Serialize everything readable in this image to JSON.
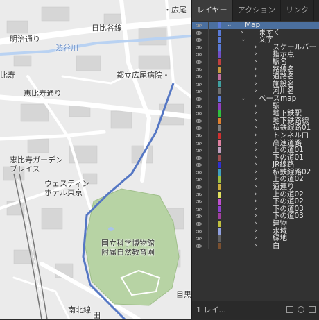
{
  "map": {
    "labels": [
      {
        "id": "hiroo-top",
        "text": "・広尾"
      },
      {
        "id": "meiji-dori",
        "text": "明治通り"
      },
      {
        "id": "hibiya-line",
        "text": "日比谷線"
      },
      {
        "id": "shibuya-gawa",
        "text": "渋谷川"
      },
      {
        "id": "hiroo-hospital",
        "text": "都立広尾病院・"
      },
      {
        "id": "ebisu",
        "text": "比寿"
      },
      {
        "id": "ebisu-dori",
        "text": "恵比寿通り"
      },
      {
        "id": "garden-place",
        "text": "恵比寿ガーデン\nプレイス"
      },
      {
        "id": "westin",
        "text": "ウェスティン\nホテル東京"
      },
      {
        "id": "museum",
        "text": "国立科学博物館\n附属自然教育園"
      },
      {
        "id": "nanboku-line",
        "text": "南北線"
      },
      {
        "id": "meguro",
        "text": "目黒"
      },
      {
        "id": "kita",
        "text": "田"
      }
    ]
  },
  "panel": {
    "tabs": [
      {
        "label": "レイヤー",
        "active": true
      },
      {
        "label": "アクション",
        "active": false
      },
      {
        "label": "リンク",
        "active": false
      }
    ],
    "layers": [
      {
        "name": "Map",
        "level": 0,
        "expanded": true,
        "color": "#5a7bd8",
        "top": true
      },
      {
        "name": "ますく",
        "level": 1,
        "expanded": false,
        "color": "#5a7bd8"
      },
      {
        "name": "文字",
        "level": 1,
        "expanded": true,
        "color": "#5a7bd8"
      },
      {
        "name": "スケールバー",
        "level": 2,
        "expanded": false,
        "color": "#5a7bd8"
      },
      {
        "name": "指示点",
        "level": 2,
        "expanded": false,
        "color": "#7050c8"
      },
      {
        "name": "駅名",
        "level": 2,
        "expanded": false,
        "color": "#c04040"
      },
      {
        "name": "路線名",
        "level": 2,
        "expanded": false,
        "color": "#c89b40"
      },
      {
        "name": "道路名",
        "level": 2,
        "expanded": false,
        "color": "#c070a0"
      },
      {
        "name": "施設名",
        "level": 2,
        "expanded": false,
        "color": "#40a0a0"
      },
      {
        "name": "河川名",
        "level": 2,
        "expanded": false,
        "color": "#707070"
      },
      {
        "name": "ベースmap",
        "level": 1,
        "expanded": true,
        "color": "#5a7bd8"
      },
      {
        "name": "駅",
        "level": 2,
        "expanded": false,
        "color": "#9040c0"
      },
      {
        "name": "地下鉄駅",
        "level": 2,
        "expanded": false,
        "color": "#30c040"
      },
      {
        "name": "地下鉄路線",
        "level": 2,
        "expanded": false,
        "color": "#e08030"
      },
      {
        "name": "私鉄線路01",
        "level": 2,
        "expanded": false,
        "color": "#808080"
      },
      {
        "name": "トンネル口",
        "level": 2,
        "expanded": false,
        "color": "#d03030"
      },
      {
        "name": "高速道路",
        "level": 2,
        "expanded": false,
        "color": "#e080a0"
      },
      {
        "name": "上の道01",
        "level": 2,
        "expanded": false,
        "color": "#c0a0c0"
      },
      {
        "name": "下の道01",
        "level": 2,
        "expanded": false,
        "color": "#a05050"
      },
      {
        "name": "JR線路",
        "level": 2,
        "expanded": false,
        "color": "#3030d0"
      },
      {
        "name": "私鉄線路02",
        "level": 2,
        "expanded": false,
        "color": "#40a0c0"
      },
      {
        "name": "上の道02",
        "level": 2,
        "expanded": false,
        "color": "#a0c040"
      },
      {
        "name": "道連り",
        "level": 2,
        "expanded": false,
        "color": "#d0b040"
      },
      {
        "name": "上の道02",
        "level": 2,
        "expanded": false,
        "color": "#e0e060"
      },
      {
        "name": "下の道02",
        "level": 2,
        "expanded": false,
        "color": "#c050d0"
      },
      {
        "name": "下の道03",
        "level": 2,
        "expanded": false,
        "color": "#9040d0"
      },
      {
        "name": "下の道03",
        "level": 2,
        "expanded": false,
        "color": "#a040a0"
      },
      {
        "name": "建物",
        "level": 2,
        "expanded": false,
        "color": "#c0c040"
      },
      {
        "name": "水域",
        "level": 2,
        "expanded": false,
        "color": "#90a0e0"
      },
      {
        "name": "緑地",
        "level": 2,
        "expanded": false,
        "color": "#606060"
      },
      {
        "name": "白",
        "level": 2,
        "expanded": false,
        "color": "#7a5030"
      }
    ],
    "footer": {
      "count_label": "1 レイ..."
    }
  }
}
